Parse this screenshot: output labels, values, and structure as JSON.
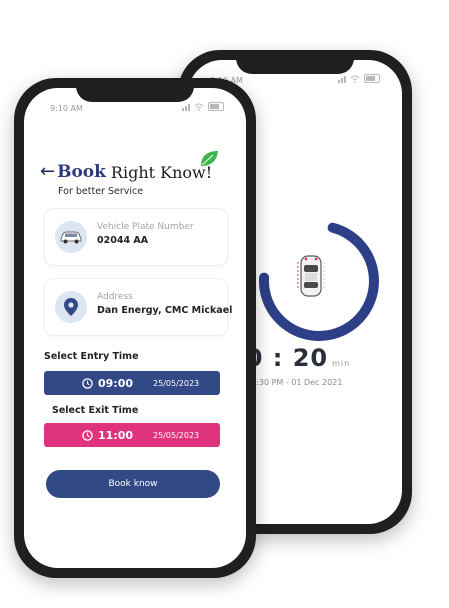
{
  "back_screen": {
    "status_time": "9:10 AM",
    "timer": "30 : 20",
    "timer_unit": "min",
    "date_line": "10:30 PM - 01 Dec 2021",
    "progress": 0.72,
    "ring_color": "#2d3f86"
  },
  "front_screen": {
    "status_time": "9:10 AM",
    "title_book": "Book",
    "title_rest": "Right Know!",
    "subtitle": "For better Service",
    "vehicle": {
      "label": "Vehicle Plate Number",
      "value": "02044 AA",
      "icon": "car-icon"
    },
    "address": {
      "label": "Address",
      "value": "Dan Energy, CMC Mickael",
      "icon": "location-pin-icon"
    },
    "entry": {
      "section_label": "Select Entry Time",
      "time": "09:00",
      "date": "25/05/2023"
    },
    "exit": {
      "section_label": "Select Exit Time",
      "time": "11:00",
      "date": "25/05/2023"
    },
    "book_button": "Book know",
    "colors": {
      "primary": "#334986",
      "accent": "#e0337e",
      "leaf": "#3cb54a"
    }
  }
}
